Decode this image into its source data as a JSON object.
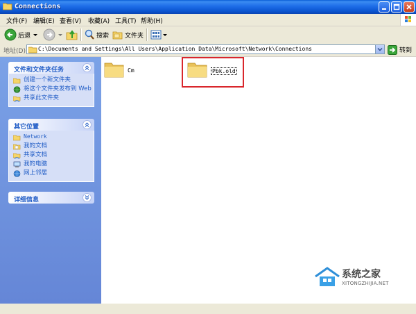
{
  "window": {
    "title": "Connections",
    "buttons": {
      "minimize": "_",
      "maximize": "□",
      "close": "×"
    }
  },
  "menu": [
    "文件(F)",
    "编辑(E)",
    "查看(V)",
    "收藏(A)",
    "工具(T)",
    "帮助(H)"
  ],
  "toolbar": {
    "back": "后退",
    "search": "搜索",
    "folders": "文件夹"
  },
  "address": {
    "label": "地址(D)",
    "path": "C:\\Documents and Settings\\All Users\\Application Data\\Microsoft\\Network\\Connections",
    "go": "转到"
  },
  "panels": {
    "file_tasks": {
      "title": "文件和文件夹任务",
      "items": [
        "创建一个新文件夹",
        "将这个文件夹发布到 Web",
        "共享此文件夹"
      ]
    },
    "other_places": {
      "title": "其它位置",
      "items": [
        "Network",
        "我的文档",
        "共享文档",
        "我的电脑",
        "网上邻居"
      ]
    },
    "details": {
      "title": "详细信息"
    }
  },
  "folders": [
    {
      "name": "Cm"
    },
    {
      "name": "Pbk.old"
    }
  ],
  "watermark": {
    "brand": "系统之家",
    "url": "XITONGZHIJIA.NET"
  },
  "colors": {
    "titlebar": "#1e6de8",
    "task_pane": "#7ba2e7",
    "link": "#215dc6",
    "highlight": "#d9262c"
  }
}
